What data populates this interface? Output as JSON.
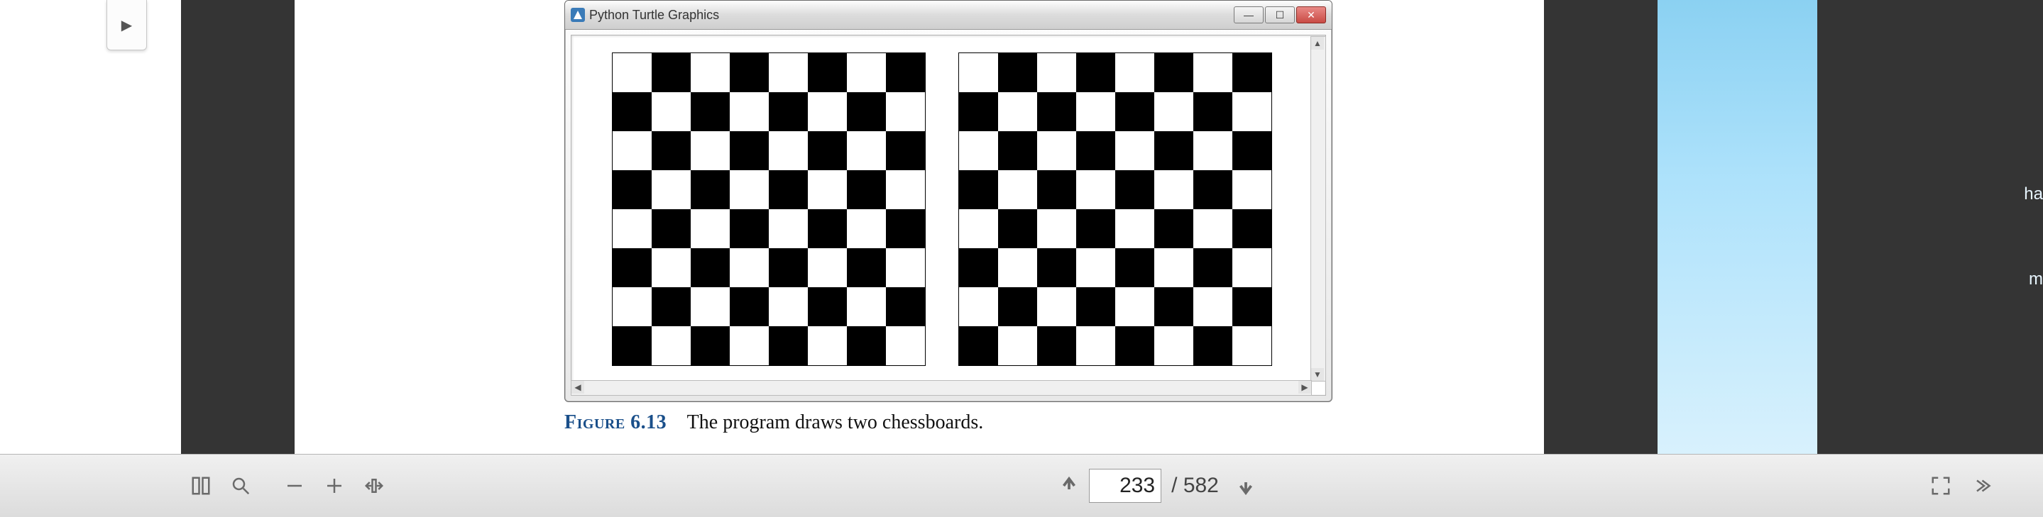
{
  "panel": {
    "expand_glyph": "▶"
  },
  "figure": {
    "window_title": "Python Turtle Graphics",
    "caption_label": "Figure 6.13",
    "caption_text": "The program draws two chessboards.",
    "board_size": 8,
    "board_count": 2
  },
  "peek_text": {
    "a": "ha",
    "b": "m"
  },
  "toolbar": {
    "current_page": "233",
    "page_separator": "/",
    "total_pages": "582"
  }
}
